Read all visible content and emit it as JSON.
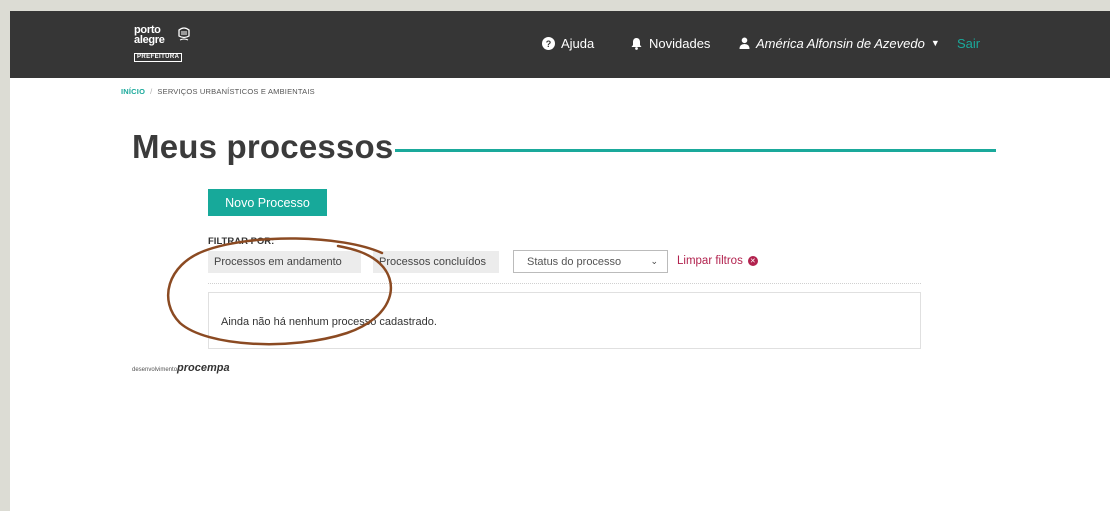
{
  "header": {
    "logo": {
      "line1": "porto",
      "line2": "alegre",
      "line3": "PREFEITURA"
    },
    "help": "Ajuda",
    "news": "Novidades",
    "user": "América Alfonsin de Azevedo",
    "exit": "Sair"
  },
  "breadcrumb": {
    "home": "INÍCIO",
    "separator": "/",
    "current": "SERVIÇOS URBANÍSTICOS E AMBIENTAIS"
  },
  "page": {
    "title": "Meus processos"
  },
  "actions": {
    "new_process": "Novo Processo"
  },
  "filters": {
    "label": "FILTRAR POR:",
    "ongoing": "Processos em andamento",
    "done": "Processos concluídos",
    "status_placeholder": "Status do processo",
    "clear": "Limpar filtros"
  },
  "empty_message": "Ainda não há nenhum processo cadastrado.",
  "footer": {
    "dev": "desenvolvimento",
    "brand": "procempa"
  },
  "colors": {
    "accent": "#1aa99b",
    "topbar": "#363636",
    "danger": "#b2224e",
    "annotation": "#8b4a22"
  }
}
